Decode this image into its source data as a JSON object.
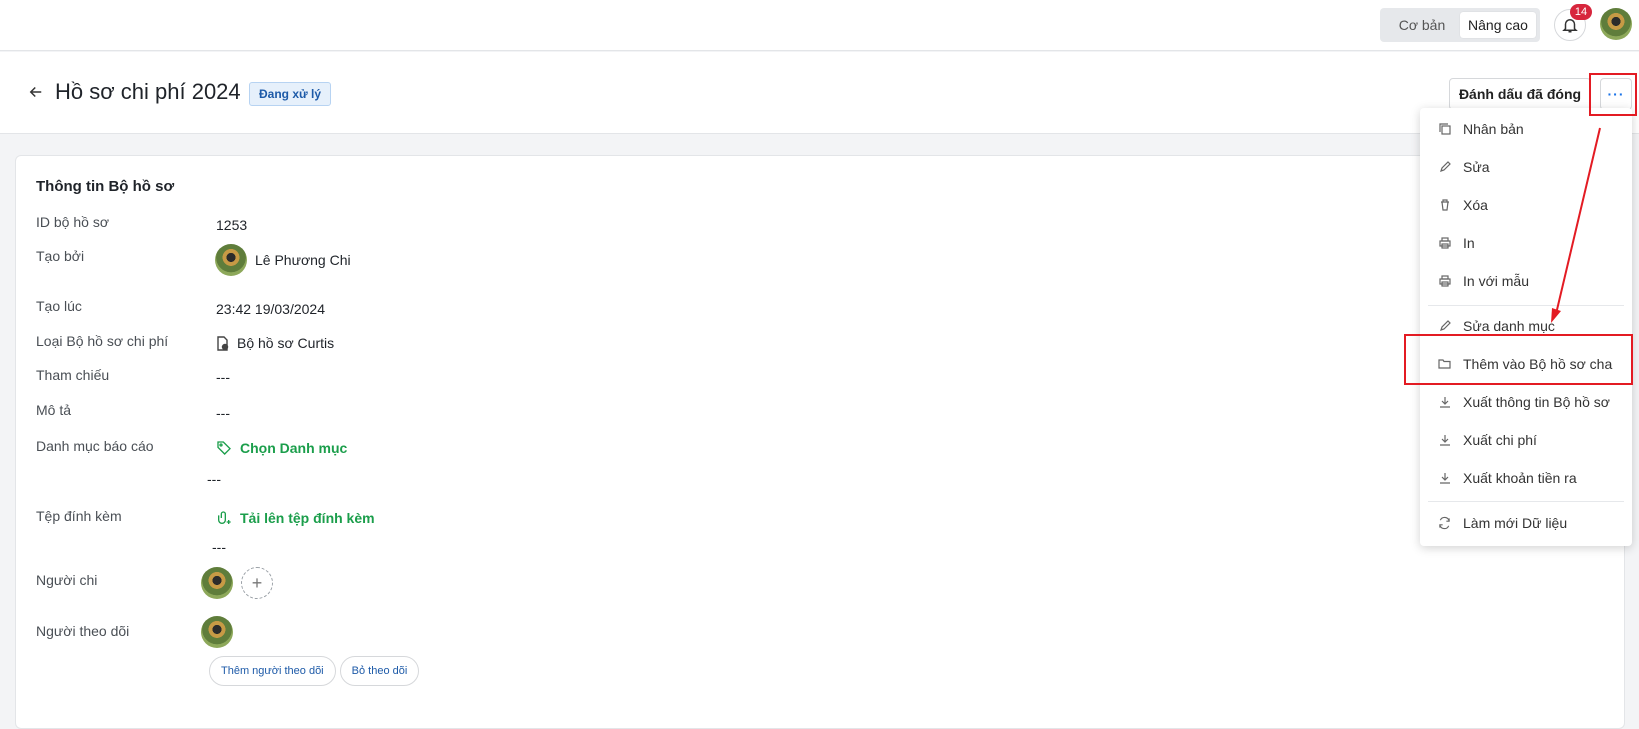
{
  "topbar": {
    "mode_basic": "Cơ bản",
    "mode_advanced": "Nâng cao",
    "notification_count": "14"
  },
  "header": {
    "title": "Hồ sơ chi phí 2024",
    "status": "Đang xử lý",
    "mark_closed_label": "Đánh dấu đã đóng",
    "more_label": "···"
  },
  "card": {
    "title": "Thông tin Bộ hồ sơ",
    "fields": {
      "id_label": "ID bộ hồ sơ",
      "id_value": "1253",
      "created_by_label": "Tạo bởi",
      "created_by_value": "Lê Phương Chi",
      "created_at_label": "Tạo lúc",
      "created_at_value": "23:42 19/03/2024",
      "type_label": "Loại Bộ hồ sơ chi phí",
      "type_value": "Bộ hồ sơ Curtis",
      "reference_label": "Tham chiếu",
      "reference_value": "---",
      "description_label": "Mô tả",
      "description_value": "---",
      "category_label": "Danh mục báo cáo",
      "category_action": "Chọn Danh mục",
      "category_value": "---",
      "attachment_label": "Tệp đính kèm",
      "attachment_action": "Tải lên tệp đính kèm",
      "attachment_value": "---",
      "payer_label": "Người chi",
      "follower_label": "Người theo dõi",
      "add_follower": "Thêm người theo dõi",
      "unfollow": "Bỏ theo dõi"
    }
  },
  "menu": {
    "items": [
      {
        "label": "Nhân bản",
        "icon": "copy-icon"
      },
      {
        "label": "Sửa",
        "icon": "edit-icon"
      },
      {
        "label": "Xóa",
        "icon": "trash-icon"
      },
      {
        "label": "In",
        "icon": "print-icon"
      },
      {
        "label": "In với mẫu",
        "icon": "print-icon"
      },
      {
        "label": "Sửa danh mục",
        "icon": "edit-icon"
      },
      {
        "label": "Thêm vào Bộ hồ sơ cha",
        "icon": "folder-icon"
      },
      {
        "label": "Xuất thông tin Bộ hồ sơ",
        "icon": "download-icon"
      },
      {
        "label": "Xuất chi phí",
        "icon": "download-icon"
      },
      {
        "label": "Xuất khoản tiền ra",
        "icon": "download-icon"
      },
      {
        "label": "Làm mới Dữ liệu",
        "icon": "refresh-icon"
      }
    ]
  },
  "colors": {
    "accent_green": "#1b9e4b",
    "accent_blue": "#1a73e8",
    "annotation_red": "#e31b23"
  }
}
